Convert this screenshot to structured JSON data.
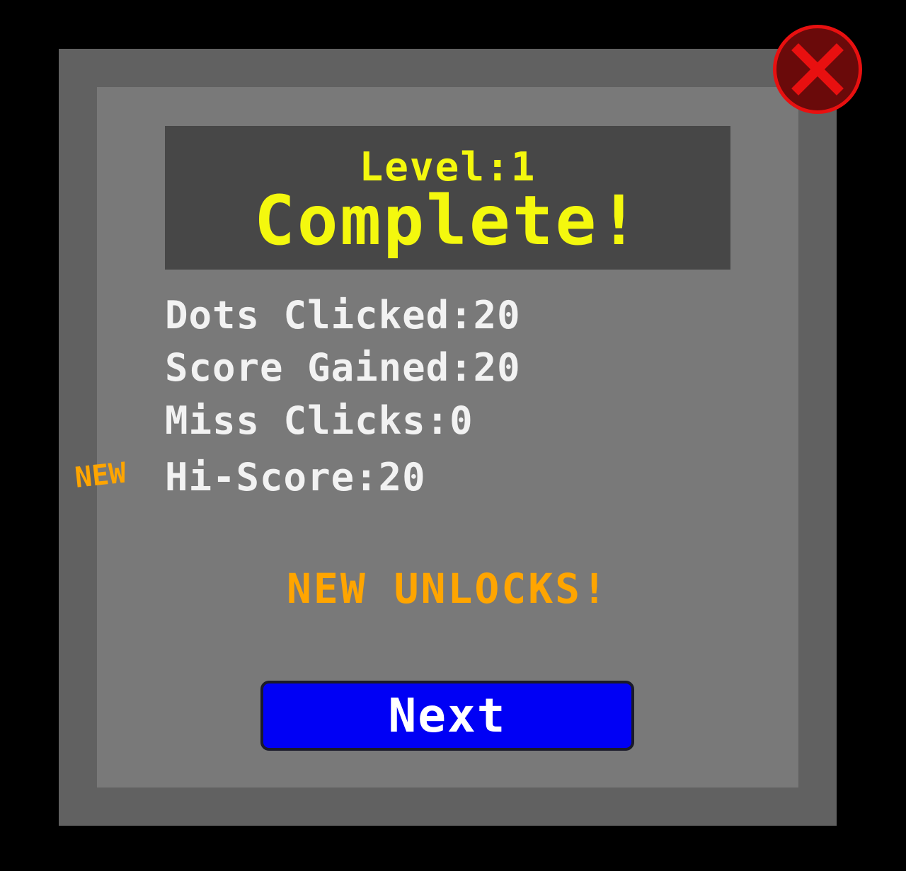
{
  "header": {
    "level_label": "Level:1",
    "title": "Complete!"
  },
  "stats": {
    "dots_clicked": "Dots Clicked:20",
    "score_gained": "Score Gained:20",
    "miss_clicks": "Miss Clicks:0",
    "hi_score": "Hi-Score:20",
    "new_badge": "NEW"
  },
  "unlocks": {
    "label": "NEW UNLOCKS!"
  },
  "actions": {
    "next_label": "Next",
    "close_icon": "close-x-icon"
  },
  "colors": {
    "title_yellow": "#f4f80e",
    "accent_orange": "#ffa500",
    "next_blue": "#0000f5",
    "close_red": "#e81010"
  }
}
